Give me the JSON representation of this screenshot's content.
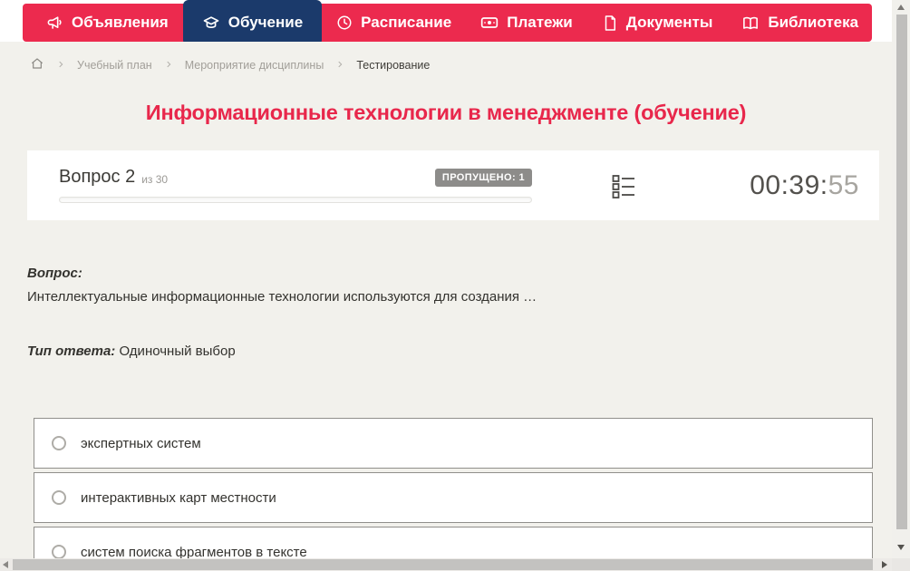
{
  "nav": {
    "items": [
      {
        "label": "Объявления",
        "icon": "megaphone-icon",
        "active": false
      },
      {
        "label": "Обучение",
        "icon": "graduation-cap-icon",
        "active": true
      },
      {
        "label": "Расписание",
        "icon": "clock-icon",
        "active": false
      },
      {
        "label": "Платежи",
        "icon": "banknote-icon",
        "active": false
      },
      {
        "label": "Документы",
        "icon": "document-icon",
        "active": false
      },
      {
        "label": "Библиотека",
        "icon": "book-icon",
        "active": false,
        "has_dropdown": true
      }
    ],
    "colors": {
      "bar": "#ec2a4e",
      "active_item": "#1b3a6b"
    }
  },
  "breadcrumb": {
    "items": [
      "Учебный план",
      "Мероприятие дисциплины",
      "Тестирование"
    ]
  },
  "page": {
    "title": "Информационные технологии в менеджменте (обучение)",
    "title_color": "#e8274b"
  },
  "quiz": {
    "question_label": "Вопрос 2",
    "question_of": "из 30",
    "skipped_badge": "ПРОПУЩЕНО: 1",
    "progress_percent": 0,
    "timer": {
      "main": "00:39:",
      "seconds": "55"
    }
  },
  "question": {
    "heading": "Вопрос:",
    "text": "Интеллектуальные информационные технологии используются для создания …",
    "type_label": "Тип ответа:",
    "type_value": "Одиночный выбор",
    "options": [
      "экспертных систем",
      "интерактивных карт местности",
      "систем поиска фрагментов в тексте"
    ]
  }
}
